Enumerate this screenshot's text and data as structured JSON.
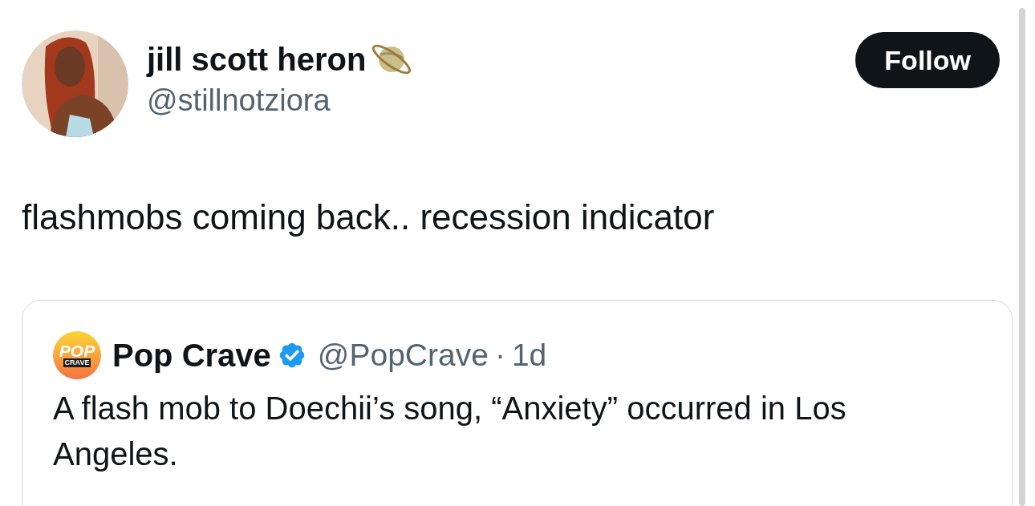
{
  "author": {
    "name": "jill scott heron",
    "handle": "@stillnotziora"
  },
  "follow_button": {
    "label": "Follow"
  },
  "tweet_text": "flashmobs coming back.. recession indicator",
  "quoted_tweet": {
    "logo_text": [
      "POP",
      "CRAVE"
    ],
    "name": "Pop Crave",
    "verified": true,
    "handle": "@PopCrave",
    "separator": "·",
    "time": "1d",
    "text": "A flash mob to Doechii’s song, “Anxiety” occurred in Los Angeles."
  }
}
